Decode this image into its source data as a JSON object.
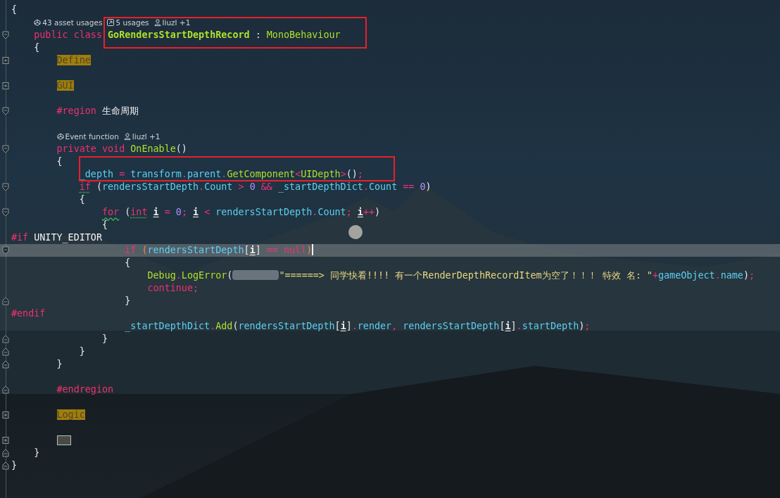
{
  "editor": {
    "lines": [
      {
        "kind": "code",
        "current": false,
        "tokens": [
          {
            "text": "{",
            "kind": "punct"
          }
        ]
      },
      {
        "kind": "hint",
        "current": false,
        "items": [
          {
            "kind": "assets",
            "text": "43 asset usages"
          },
          {
            "kind": "usages",
            "text": "5 usages"
          },
          {
            "kind": "authors",
            "text": "liuzl +1"
          }
        ]
      },
      {
        "kind": "code",
        "current": false,
        "gutter": {
          "kind": "start",
          "collapsed": false
        },
        "tokens": [
          {
            "text": "    public class",
            "kind": "kw"
          },
          {
            "text": " GoRendersStartDepthRecord",
            "kind": "class"
          },
          {
            "text": " : ",
            "kind": "punct"
          },
          {
            "text": "MonoBehaviour",
            "kind": "type"
          }
        ]
      },
      {
        "kind": "code",
        "current": false,
        "tokens": [
          {
            "text": "    {",
            "kind": "punct"
          }
        ]
      },
      {
        "kind": "code",
        "current": false,
        "gutter": {
          "kind": "start",
          "collapsed": true
        },
        "tokens": [
          {
            "text": "        Define",
            "kind": "region"
          }
        ]
      },
      {
        "kind": "blank",
        "current": false
      },
      {
        "kind": "code",
        "current": false,
        "gutter": {
          "kind": "start",
          "collapsed": true
        },
        "tokens": [
          {
            "text": "        GUI",
            "kind": "region"
          }
        ]
      },
      {
        "kind": "blank",
        "current": false
      },
      {
        "kind": "code",
        "current": false,
        "gutter": {
          "kind": "start",
          "collapsed": false
        },
        "tokens": [
          {
            "text": "        #region",
            "kind": "preproc"
          },
          {
            "text": " 生命周期",
            "kind": "plain"
          }
        ]
      },
      {
        "kind": "blank",
        "current": false
      },
      {
        "kind": "hint",
        "current": false,
        "items": [
          {
            "kind": "assets",
            "text": "Event function"
          },
          {
            "kind": "authors",
            "text": "liuzl +1"
          }
        ]
      },
      {
        "kind": "code",
        "current": false,
        "gutter": {
          "kind": "start",
          "collapsed": false
        },
        "tokens": [
          {
            "text": "        private void",
            "kind": "kw"
          },
          {
            "text": " OnEnable",
            "kind": "method"
          },
          {
            "text": "()",
            "kind": "punct"
          }
        ]
      },
      {
        "kind": "code",
        "current": false,
        "tokens": [
          {
            "text": "        {",
            "kind": "punct"
          }
        ]
      },
      {
        "kind": "code",
        "current": false,
        "tokens": [
          {
            "text": "            _depth",
            "kind": "field"
          },
          {
            "text": " = ",
            "kind": "op"
          },
          {
            "text": "transform",
            "kind": "field"
          },
          {
            "text": ".",
            "kind": "op"
          },
          {
            "text": "parent",
            "kind": "field"
          },
          {
            "text": ".",
            "kind": "op"
          },
          {
            "text": "GetComponent",
            "kind": "method"
          },
          {
            "text": "<",
            "kind": "op"
          },
          {
            "text": "UIDepth",
            "kind": "type"
          },
          {
            "text": ">",
            "kind": "op"
          },
          {
            "text": "()",
            "kind": "punct"
          },
          {
            "text": ";",
            "kind": "op"
          }
        ]
      },
      {
        "kind": "code",
        "current": false,
        "gutter": {
          "kind": "start",
          "collapsed": false
        },
        "tokens": [
          {
            "text": "            if",
            "kind": "kw-dotted"
          },
          {
            "text": " (",
            "kind": "punct"
          },
          {
            "text": "rendersStartDepth",
            "kind": "field"
          },
          {
            "text": ".",
            "kind": "op"
          },
          {
            "text": "Count",
            "kind": "field"
          },
          {
            "text": " > ",
            "kind": "op"
          },
          {
            "text": "0",
            "kind": "num"
          },
          {
            "text": " && ",
            "kind": "op"
          },
          {
            "text": "_startDepthDict",
            "kind": "field"
          },
          {
            "text": ".",
            "kind": "op"
          },
          {
            "text": "Count",
            "kind": "field"
          },
          {
            "text": " == ",
            "kind": "op"
          },
          {
            "text": "0",
            "kind": "num"
          },
          {
            "text": ")",
            "kind": "punct"
          }
        ]
      },
      {
        "kind": "code",
        "current": false,
        "tokens": [
          {
            "text": "            {",
            "kind": "punct"
          }
        ]
      },
      {
        "kind": "code",
        "current": false,
        "gutter": {
          "kind": "start",
          "collapsed": false
        },
        "tokens": [
          {
            "text": "                for",
            "kind": "kw-wavy"
          },
          {
            "text": " (",
            "kind": "punct"
          },
          {
            "text": "int",
            "kind": "kw-dotted"
          },
          {
            "text": " i",
            "kind": "var"
          },
          {
            "text": " = ",
            "kind": "op"
          },
          {
            "text": "0",
            "kind": "num"
          },
          {
            "text": "; ",
            "kind": "op"
          },
          {
            "text": "i",
            "kind": "var"
          },
          {
            "text": " < ",
            "kind": "op"
          },
          {
            "text": "rendersStartDepth",
            "kind": "field"
          },
          {
            "text": ".",
            "kind": "op"
          },
          {
            "text": "Count",
            "kind": "field"
          },
          {
            "text": "; ",
            "kind": "op"
          },
          {
            "text": "i",
            "kind": "var"
          },
          {
            "text": "++",
            "kind": "op"
          },
          {
            "text": ")",
            "kind": "punct"
          }
        ]
      },
      {
        "kind": "code",
        "current": false,
        "tokens": [
          {
            "text": "                {",
            "kind": "punct"
          }
        ]
      },
      {
        "kind": "code",
        "current": false,
        "tokens": [
          {
            "text": "#if",
            "kind": "preproc"
          },
          {
            "text": " UNITY_EDITOR",
            "kind": "plain"
          }
        ]
      },
      {
        "kind": "code",
        "current": true,
        "gutter": {
          "kind": "start",
          "collapsed": false
        },
        "tokens": [
          {
            "text": "                    if",
            "kind": "kw"
          },
          {
            "text": " (",
            "kind": "match"
          },
          {
            "text": "rendersStartDepth",
            "kind": "field"
          },
          {
            "text": "[",
            "kind": "punct"
          },
          {
            "text": "i",
            "kind": "var"
          },
          {
            "text": "]",
            "kind": "punct"
          },
          {
            "text": " == ",
            "kind": "op"
          },
          {
            "text": "null",
            "kind": "kw"
          },
          {
            "text": ")",
            "kind": "match"
          }
        ]
      },
      {
        "kind": "code",
        "current": false,
        "tokens": [
          {
            "text": "                    {",
            "kind": "punct"
          }
        ]
      },
      {
        "kind": "code",
        "current": false,
        "tokens": [
          {
            "text": "                        Debug",
            "kind": "method"
          },
          {
            "text": ".",
            "kind": "op"
          },
          {
            "text": "LogError",
            "kind": "method"
          },
          {
            "text": "(",
            "kind": "punct"
          },
          {
            "kind": "redacted"
          },
          {
            "text": "\"======> 同学快看!!!! 有一个RenderDepthRecordItem为空了！！！ 特效 名: \"",
            "kind": "string"
          },
          {
            "text": "+",
            "kind": "op"
          },
          {
            "text": "gameObject",
            "kind": "field"
          },
          {
            "text": ".",
            "kind": "op"
          },
          {
            "text": "name",
            "kind": "field"
          },
          {
            "text": ")",
            "kind": "punct"
          },
          {
            "text": ";",
            "kind": "op"
          }
        ]
      },
      {
        "kind": "code",
        "current": false,
        "tokens": [
          {
            "text": "                        continue;",
            "kind": "kw"
          }
        ]
      },
      {
        "kind": "code",
        "current": false,
        "gutter": {
          "kind": "end",
          "collapsed": false
        },
        "tokens": [
          {
            "text": "                    }",
            "kind": "punct"
          }
        ]
      },
      {
        "kind": "code",
        "current": false,
        "tokens": [
          {
            "text": "#endif",
            "kind": "preproc"
          }
        ]
      },
      {
        "kind": "code",
        "current": false,
        "tokens": [
          {
            "text": "                    _startDepthDict",
            "kind": "field"
          },
          {
            "text": ".",
            "kind": "op"
          },
          {
            "text": "Add",
            "kind": "method"
          },
          {
            "text": "(",
            "kind": "punct"
          },
          {
            "text": "rendersStartDepth",
            "kind": "field"
          },
          {
            "text": "[",
            "kind": "punct"
          },
          {
            "text": "i",
            "kind": "var"
          },
          {
            "text": "]",
            "kind": "punct"
          },
          {
            "text": ".",
            "kind": "op"
          },
          {
            "text": "render",
            "kind": "field"
          },
          {
            "text": ", ",
            "kind": "op"
          },
          {
            "text": "rendersStartDepth",
            "kind": "field"
          },
          {
            "text": "[",
            "kind": "punct"
          },
          {
            "text": "i",
            "kind": "var"
          },
          {
            "text": "]",
            "kind": "punct"
          },
          {
            "text": ".",
            "kind": "op"
          },
          {
            "text": "startDepth",
            "kind": "field"
          },
          {
            "text": ")",
            "kind": "punct"
          },
          {
            "text": ";",
            "kind": "op"
          }
        ]
      },
      {
        "kind": "code",
        "current": false,
        "gutter": {
          "kind": "end",
          "collapsed": false
        },
        "tokens": [
          {
            "text": "                }",
            "kind": "punct"
          }
        ]
      },
      {
        "kind": "code",
        "current": false,
        "gutter": {
          "kind": "end",
          "collapsed": false
        },
        "tokens": [
          {
            "text": "            }",
            "kind": "punct"
          }
        ]
      },
      {
        "kind": "code",
        "current": false,
        "gutter": {
          "kind": "end",
          "collapsed": false
        },
        "tokens": [
          {
            "text": "        }",
            "kind": "punct"
          }
        ]
      },
      {
        "kind": "blank",
        "current": false
      },
      {
        "kind": "code",
        "current": false,
        "gutter": {
          "kind": "end",
          "collapsed": false
        },
        "tokens": [
          {
            "text": "        #endregion",
            "kind": "preproc"
          }
        ]
      },
      {
        "kind": "blank",
        "current": false
      },
      {
        "kind": "code",
        "current": false,
        "gutter": {
          "kind": "start",
          "collapsed": true
        },
        "tokens": [
          {
            "text": "        Logic",
            "kind": "region"
          }
        ]
      },
      {
        "kind": "blank",
        "current": false
      },
      {
        "kind": "folded",
        "current": false,
        "gutter": {
          "kind": "start",
          "collapsed": true
        }
      },
      {
        "kind": "code",
        "current": false,
        "gutter": {
          "kind": "end",
          "collapsed": false
        },
        "tokens": [
          {
            "text": "    }",
            "kind": "punct"
          }
        ]
      },
      {
        "kind": "code",
        "current": false,
        "gutter": {
          "kind": "end",
          "collapsed": false
        },
        "tokens": [
          {
            "text": "}",
            "kind": "punct"
          }
        ]
      }
    ]
  }
}
